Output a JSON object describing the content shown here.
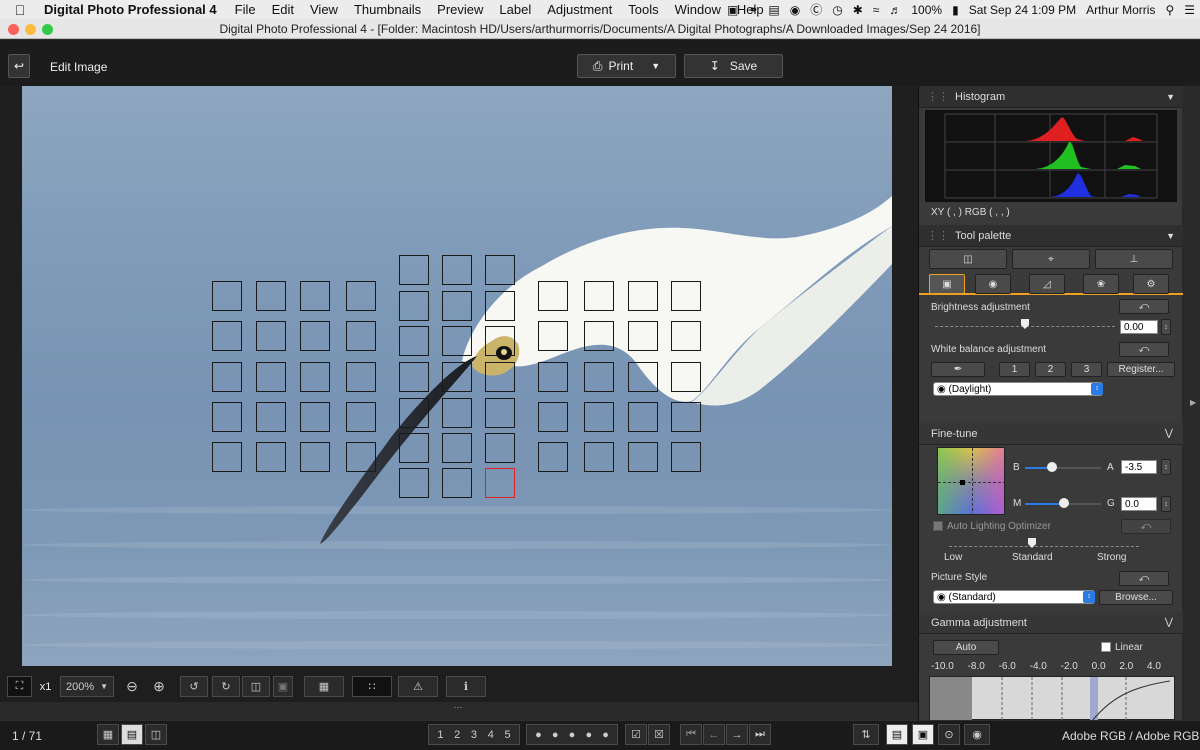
{
  "menubar": {
    "app_name": "Digital Photo Professional 4",
    "items": [
      "File",
      "Edit",
      "View",
      "Thumbnails",
      "Preview",
      "Label",
      "Adjustment",
      "Tools",
      "Window",
      "Help"
    ],
    "battery": "100%",
    "clock": "Sat Sep 24  1:09 PM",
    "user": "Arthur Morris"
  },
  "window": {
    "title": "Digital Photo Professional 4 - [Folder: Macintosh HD/Users/arthurmorris/Documents/A Digital Photographs/A Downloaded Images/Sep 24 2016]"
  },
  "toolbar": {
    "edit_image_label": "Edit Image",
    "print_label": "Print",
    "save_label": "Save"
  },
  "histogram": {
    "title": "Histogram",
    "xy_readout": "XY (          ,          )  RGB (          ,          ,          )"
  },
  "tool_palette": {
    "title": "Tool palette",
    "brightness_label": "Brightness adjustment",
    "brightness_value": "0.00",
    "brightness_level": 0.5,
    "wb_label": "White balance adjustment",
    "wb_presets": [
      "1",
      "2",
      "3"
    ],
    "register_label": "Register...",
    "wb_select": "(Daylight)"
  },
  "fine_tune": {
    "title": "Fine-tune",
    "b_label": "B",
    "a_label": "A",
    "a_value": "-3.5",
    "m_label": "M",
    "g_label": "G",
    "g_value": "0.0",
    "alo_label": "Auto Lighting Optimizer",
    "low_label": "Low",
    "standard_label": "Standard",
    "strong_label": "Strong",
    "picture_style_label": "Picture Style",
    "picture_style_value": "(Standard)",
    "browse_label": "Browse..."
  },
  "gamma": {
    "title": "Gamma adjustment",
    "auto_label": "Auto",
    "linear_label": "Linear",
    "ticks": [
      "-10.0",
      "-8.0",
      "-6.0",
      "-4.0",
      "-2.0",
      "0.0",
      "2.0",
      "4.0"
    ]
  },
  "view_controls": {
    "x1_label": "x1",
    "zoom_value": "200%"
  },
  "status": {
    "page_count": "1 / 71",
    "rating_labels": [
      "1",
      "2",
      "3",
      "4",
      "5"
    ],
    "color_space": "Adobe RGB / Adobe RGB"
  },
  "colors": {
    "accent_orange": "#f0a020",
    "af_selected": "#d22222",
    "hist_red": "#e02020",
    "hist_green": "#20c020",
    "hist_blue": "#2030e0"
  }
}
